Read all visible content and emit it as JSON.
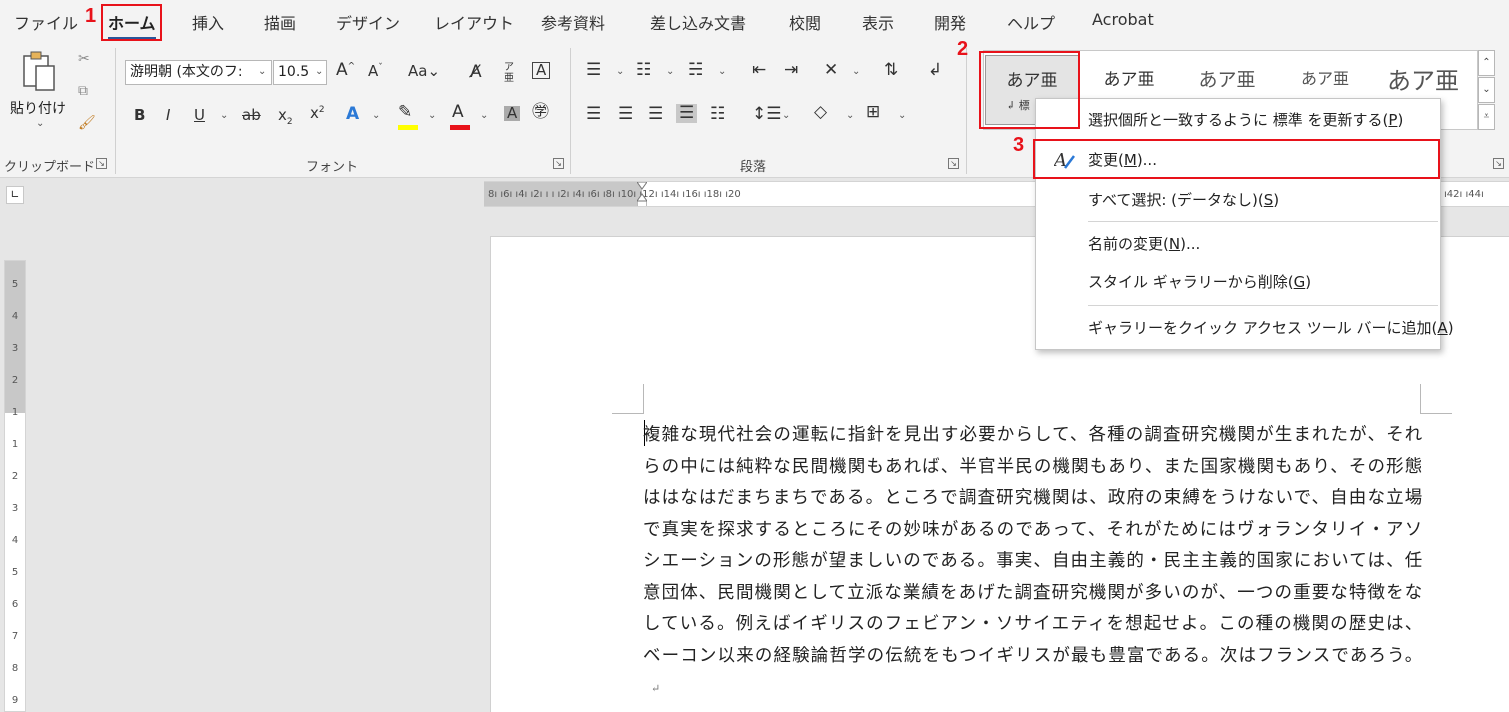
{
  "tabs": [
    "ファイル",
    "ホーム",
    "挿入",
    "描画",
    "デザイン",
    "レイアウト",
    "参考資料",
    "差し込み文書",
    "校閲",
    "表示",
    "開発",
    "ヘルプ",
    "Acrobat"
  ],
  "active_tab": "ホーム",
  "clipboard": {
    "paste_label": "貼り付け",
    "group_label": "クリップボード"
  },
  "font": {
    "font_name": "游明朝 (本文のフ:",
    "font_size": "10.5",
    "group_label": "フォント"
  },
  "paragraph": {
    "group_label": "段落"
  },
  "styles": {
    "items": [
      "あア亜",
      "あア亜",
      "あア亜",
      "あア亜",
      "あア亜"
    ],
    "first_sub_label": "↲ 標"
  },
  "context_menu": {
    "items": [
      {
        "text": "選択個所と一致するように 標準 を更新する(",
        "key": "P",
        "end": ")"
      },
      {
        "text": "変更(",
        "key": "M",
        "end": ")..."
      },
      {
        "text": "すべて選択: (データなし)(",
        "key": "S",
        "end": ")"
      },
      {
        "text": "名前の変更(",
        "key": "N",
        "end": ")..."
      },
      {
        "text": "スタイル ギャラリーから削除(",
        "key": "G",
        "end": ")"
      },
      {
        "text": "ギャラリーをクイック アクセス ツール バーに追加(",
        "key": "A",
        "end": ")"
      }
    ]
  },
  "ruler": {
    "horizontal": "8ı  ı6ı  ı4ı  ı2ı  ı     ı  ı2ı  ı4ı  ı6ı  ı8ı  ı10ı  ı12ı  ı14ı  ı16ı  ı18ı  ı20",
    "horizontal_right": "ı42ı  ı44ı",
    "vertical": [
      "5",
      "4",
      "3",
      "2",
      "1",
      "1",
      "2",
      "3",
      "4",
      "5",
      "6",
      "7",
      "8",
      "9"
    ]
  },
  "document": {
    "body": "複雑な現代社会の運転に指針を見出す必要からして、各種の調査研究機関が生まれたが、それらの中には純粋な民間機関もあれば、半官半民の機関もあり、また国家機関もあり、その形態ははなはだまちまちである。ところで調査研究機関は、政府の束縛をうけないで、自由な立場で真実を探求するところにその妙味があるのであって、それがためにはヴォランタリイ・アソシエーションの形態が望ましいのである。事実、自由主義的・民主主義的国家においては、任意団体、民間機関として立派な業績をあげた調査研究機関が多いのが、一つの重要な特徴をなしている。例えばイギリスのフェビアン・ソサイエティを想起せよ。この種の機関の歴史は、ベーコン以来の経験論哲学の伝統をもつイギリスが最も豊富である。次はフランスであろう。",
    "paragraph_mark": "↵"
  },
  "annotations": {
    "step1": "1",
    "step2": "2",
    "step3": "3",
    "color": "#e8121a"
  },
  "colors": {
    "accent": "#2b579a",
    "font_color_bar": "#e8121a",
    "highlight_bar": "#ffff00"
  }
}
